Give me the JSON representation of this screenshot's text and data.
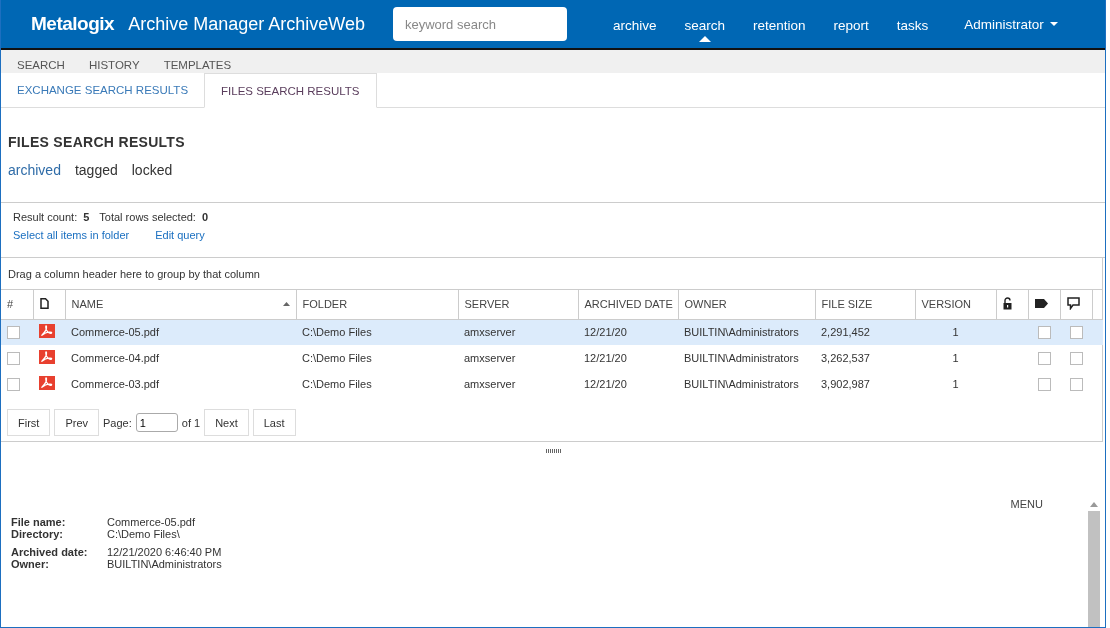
{
  "header": {
    "logo": "Metalogix",
    "title": "Archive Manager ArchiveWeb",
    "search": {
      "placeholder": "keyword search"
    },
    "nav": [
      {
        "label": "archive",
        "selected": false
      },
      {
        "label": "search",
        "selected": true
      },
      {
        "label": "retention",
        "selected": false
      },
      {
        "label": "report",
        "selected": false
      },
      {
        "label": "tasks",
        "selected": false
      }
    ],
    "user": "Administrator"
  },
  "subnav": [
    "SEARCH",
    "HISTORY",
    "TEMPLATES"
  ],
  "tabs": [
    {
      "label": "EXCHANGE SEARCH RESULTS",
      "selected": false
    },
    {
      "label": "FILES SEARCH RESULTS",
      "selected": true
    }
  ],
  "heading": "FILES SEARCH RESULTS",
  "filters": [
    {
      "label": "archived",
      "selected": true
    },
    {
      "label": "tagged",
      "selected": false
    },
    {
      "label": "locked",
      "selected": false
    }
  ],
  "summary": {
    "result_label": "Result count:",
    "result_count": "5",
    "selected_label": "Total rows selected:",
    "selected_count": "0",
    "links": [
      "Select all items in folder",
      "Edit query"
    ]
  },
  "group_hint": "Drag a column header here to group by that column",
  "columns": [
    {
      "kind": "text",
      "label": "#"
    },
    {
      "kind": "file-icon"
    },
    {
      "kind": "text",
      "label": "NAME",
      "sorted": true
    },
    {
      "kind": "text",
      "label": "FOLDER"
    },
    {
      "kind": "text",
      "label": "SERVER"
    },
    {
      "kind": "text",
      "label": "ARCHIVED DATE"
    },
    {
      "kind": "text",
      "label": "OWNER"
    },
    {
      "kind": "text",
      "label": "FILE SIZE"
    },
    {
      "kind": "text",
      "label": "VERSION"
    },
    {
      "kind": "lock-icon"
    },
    {
      "kind": "tag-icon"
    },
    {
      "kind": "comment-icon"
    }
  ],
  "rows": [
    {
      "selected": true,
      "checked": false,
      "name": "Commerce-05.pdf",
      "folder": "C:\\Demo Files",
      "server": "amxserver",
      "archived_date": "12/21/20",
      "owner": "BUILTIN\\Administrators",
      "file_size": "2,291,452",
      "version": "1",
      "tagged": false,
      "commented": false
    },
    {
      "selected": false,
      "checked": false,
      "name": "Commerce-04.pdf",
      "folder": "C:\\Demo Files",
      "server": "amxserver",
      "archived_date": "12/21/20",
      "owner": "BUILTIN\\Administrators",
      "file_size": "3,262,537",
      "version": "1",
      "tagged": false,
      "commented": false
    },
    {
      "selected": false,
      "checked": false,
      "name": "Commerce-03.pdf",
      "folder": "C:\\Demo Files",
      "server": "amxserver",
      "archived_date": "12/21/20",
      "owner": "BUILTIN\\Administrators",
      "file_size": "3,902,987",
      "version": "1",
      "tagged": false,
      "commented": false
    }
  ],
  "pager": {
    "first": "First",
    "prev": "Prev",
    "page_label": "Page:",
    "page": "1",
    "of": "of 1",
    "next": "Next",
    "last": "Last"
  },
  "details": {
    "menu": "MENU",
    "fields": [
      {
        "label": "File name:",
        "value": "Commerce-05.pdf"
      },
      {
        "label": "Directory:",
        "value": "C:\\Demo Files\\"
      },
      {
        "label": "Archived date:",
        "value": "12/21/2020 6:46:40 PM"
      },
      {
        "label": "Owner:",
        "value": "BUILTIN\\Administrators"
      }
    ]
  }
}
